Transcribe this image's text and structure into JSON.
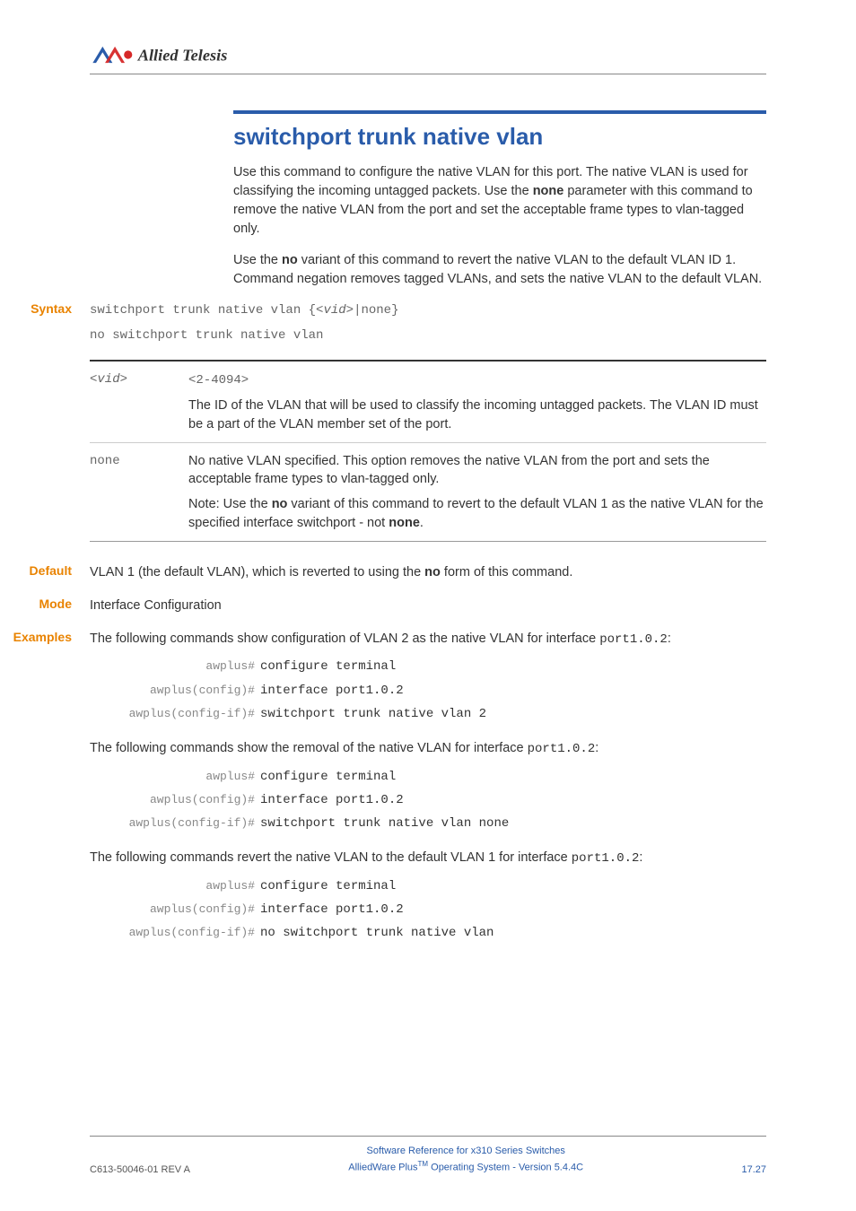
{
  "logo_text": "Allied Telesis",
  "title": "switchport trunk native vlan",
  "intro_p1_a": "Use this command to configure the native VLAN for this port. The native VLAN is used for classifying the incoming untagged packets. Use the ",
  "intro_p1_bold": "none",
  "intro_p1_b": " parameter with this command to remove the native VLAN from the port and set the acceptable frame types to vlan-tagged only.",
  "intro_p2_a": "Use the ",
  "intro_p2_bold": "no",
  "intro_p2_b": " variant of this command to revert the native VLAN to the default VLAN ID 1. Command negation removes tagged VLANs, and sets the native VLAN to the default VLAN.",
  "labels": {
    "syntax": "Syntax",
    "default": "Default",
    "mode": "Mode",
    "examples": "Examples"
  },
  "syntax": {
    "line1_a": "switchport trunk native vlan {<",
    "line1_i": "vid",
    "line1_b": ">|none}",
    "line2": "no switchport trunk native vlan"
  },
  "params": {
    "vid": {
      "key_a": "<",
      "key_i": "vid",
      "key_b": ">",
      "range": "<2-4094>",
      "desc": "The ID of the VLAN that will be used to classify the incoming untagged packets. The VLAN ID must be a part of the VLAN member set of the port."
    },
    "none": {
      "key": "none",
      "desc_p1": "No native VLAN specified. This option removes the native VLAN from the port and sets the acceptable frame types to vlan-tagged only.",
      "desc_p2_a": "Note: Use the ",
      "desc_p2_bold1": "no",
      "desc_p2_b": " variant of this command to revert to the default VLAN 1 as the native VLAN for the specified interface switchport - not ",
      "desc_p2_bold2": "none",
      "desc_p2_c": "."
    }
  },
  "default_text_a": "VLAN 1 (the default VLAN), which is reverted to using the ",
  "default_text_bold": "no",
  "default_text_b": " form of this command.",
  "mode_text": "Interface Configuration",
  "examples": {
    "intro1_a": "The following commands show configuration of VLAN 2 as the native VLAN for interface ",
    "intro1_code": "port1.0.2",
    "intro1_b": ":",
    "intro2_a": "The following commands show the removal of the native VLAN for interface ",
    "intro2_code": "port1.0.2",
    "intro2_b": ":",
    "intro3_a": "The following commands revert the native VLAN to the default VLAN 1 for interface ",
    "intro3_code": "port1.0.2",
    "intro3_b": ":"
  },
  "cli": {
    "prompt1": "awplus#",
    "prompt2": "awplus(config)#",
    "prompt3": "awplus(config-if)#",
    "cmd_conf": "configure terminal",
    "cmd_iface": "interface port1.0.2",
    "cmd_vlan2": "switchport trunk native vlan 2",
    "cmd_vlan_none": "switchport trunk native vlan none",
    "cmd_no_vlan": "no switchport trunk native vlan"
  },
  "footer": {
    "left": "C613-50046-01 REV A",
    "center1": "Software Reference for x310 Series Switches",
    "center2_a": "AlliedWare Plus",
    "center2_tm": "TM",
    "center2_b": " Operating System - Version 5.4.4C",
    "right": "17.27"
  }
}
